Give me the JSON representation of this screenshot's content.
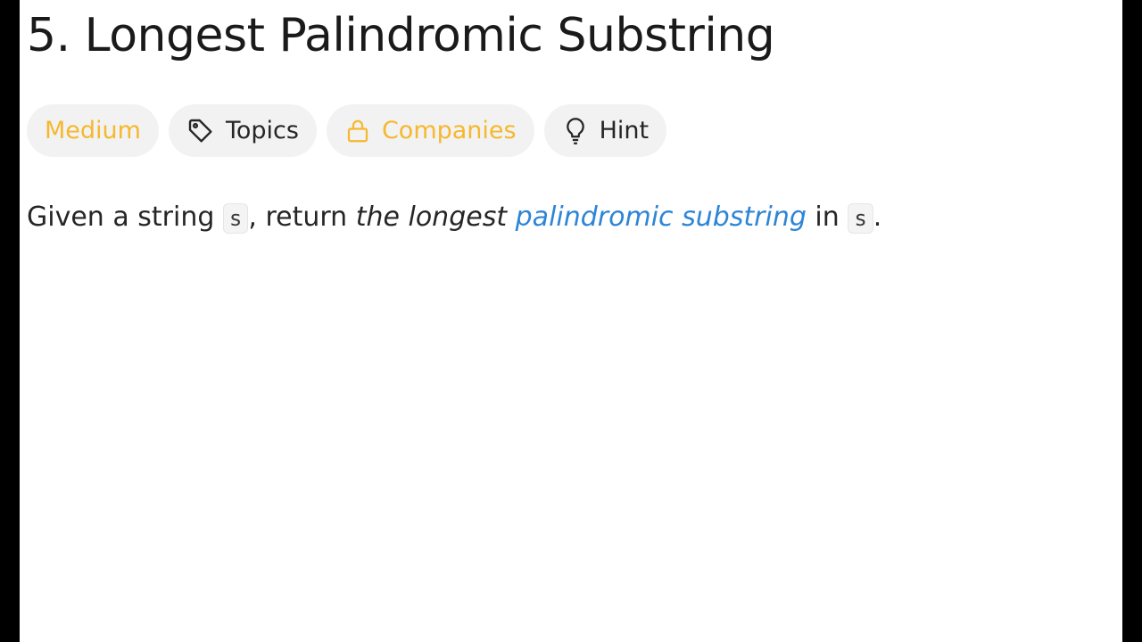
{
  "problem": {
    "title": "5. Longest Palindromic Substring",
    "difficulty": "Medium",
    "topics_label": "Topics",
    "companies_label": "Companies",
    "hint_label": "Hint",
    "description": {
      "part1": "Given a string ",
      "code1": "s",
      "part2": ", return ",
      "emphasis": "the longest",
      "space": " ",
      "link": "palindromic substring",
      "part3": " in ",
      "code2": "s",
      "part4": "."
    }
  },
  "icons": {
    "topics": "tag-icon",
    "companies": "lock-icon",
    "hint": "lightbulb-icon"
  },
  "colors": {
    "difficulty": "#f5b82e",
    "link": "#2d85d6",
    "tag_background": "#f2f2f2"
  }
}
